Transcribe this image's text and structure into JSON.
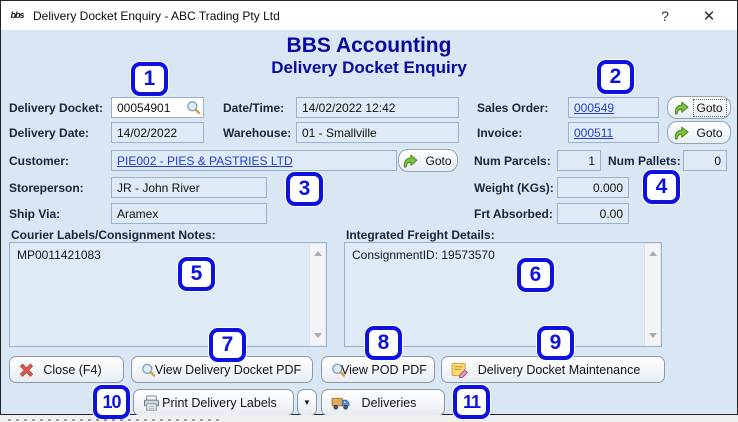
{
  "window": {
    "title": "Delivery Docket Enquiry - ABC Trading Pty Ltd",
    "icon_text": "bbs",
    "help_label": "?",
    "close_label": "✕"
  },
  "header": {
    "app_name": "BBS Accounting",
    "screen_name": "Delivery Docket Enquiry"
  },
  "fields": {
    "delivery_docket": {
      "label": "Delivery Docket:",
      "value": "00054901"
    },
    "date_time": {
      "label": "Date/Time:",
      "value": "14/02/2022 12:42"
    },
    "sales_order": {
      "label": "Sales Order:",
      "value": "000549"
    },
    "delivery_date": {
      "label": "Delivery Date:",
      "value": "14/02/2022"
    },
    "warehouse": {
      "label": "Warehouse:",
      "value": "01 - Smallville"
    },
    "invoice": {
      "label": "Invoice:",
      "value": "000511"
    },
    "customer": {
      "label": "Customer:",
      "value": "PIE002 - PIES & PASTRIES LTD"
    },
    "num_parcels": {
      "label": "Num Parcels:",
      "value": "1"
    },
    "num_pallets": {
      "label": "Num Pallets:",
      "value": "0"
    },
    "storeperson": {
      "label": "Storeperson:",
      "value": "JR - John River"
    },
    "weight_kgs": {
      "label": "Weight (KGs):",
      "value": "0.000"
    },
    "ship_via": {
      "label": "Ship Via:",
      "value": "Aramex"
    },
    "frt_absorbed": {
      "label": "Frt Absorbed:",
      "value": "0.00"
    }
  },
  "panels": {
    "courier_labels": {
      "label": "Courier Labels/Consignment Notes:",
      "value": "MP0011421083"
    },
    "integrated_freight": {
      "label": "Integrated Freight Details:",
      "value": "ConsignmentID: 19573570"
    }
  },
  "goto_label": "Goto",
  "buttons": {
    "close": "Close (F4)",
    "view_delivery_docket_pdf": "View Delivery Docket PDF",
    "view_pod_pdf": "View POD PDF",
    "delivery_docket_maintenance": "Delivery Docket Maintenance",
    "print_delivery_labels": "Print Delivery Labels",
    "print_labels_dropdown": "▼",
    "deliveries": "Deliveries"
  },
  "callouts": {
    "labels": [
      "1",
      "2",
      "3",
      "4",
      "5",
      "6",
      "7",
      "8",
      "9",
      "10",
      "11"
    ]
  },
  "icons": {
    "app-icon": "bbs monogram",
    "search-icon": "magnifier with gold handle",
    "goto-arrow-icon": "green curved right arrow",
    "close-x-icon": "red cross",
    "maintenance-icon": "yellow note with pencil",
    "print-icon": "gray printer",
    "deliveries-icon": "delivery truck",
    "dropdown-caret-icon": "down triangle",
    "scroll-up-icon": "up triangle",
    "scroll-down-icon": "down triangle"
  },
  "colors": {
    "window_bg": "#d9e6f4",
    "titlebar_bg": "#ffffff",
    "heading_navy": "#0a0a9e",
    "field_bg": "#dfeaf7",
    "field_border": "#9db2ca",
    "link_blue": "#2340cc",
    "callout_blue": "#0d12e0",
    "goto_green": "#7dc242",
    "close_red": "#e0584e"
  }
}
